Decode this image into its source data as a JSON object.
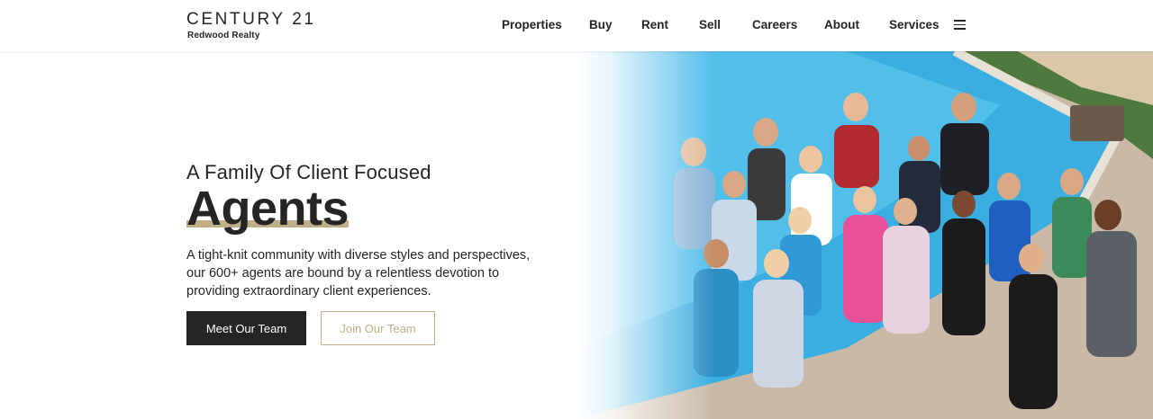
{
  "brand": {
    "name": "CENTURY 21",
    "office": "Redwood Realty"
  },
  "nav": {
    "items": [
      {
        "label": "Properties",
        "id": "properties"
      },
      {
        "label": "Buy",
        "id": "buy"
      },
      {
        "label": "Rent",
        "id": "rent"
      },
      {
        "label": "Sell",
        "id": "sell"
      },
      {
        "label": "Careers",
        "id": "careers"
      },
      {
        "label": "About",
        "id": "about"
      },
      {
        "label": "Services",
        "id": "services"
      }
    ],
    "menu_icon": "hamburger-menu-icon"
  },
  "hero": {
    "eyebrow": "A Family Of Client Focused",
    "headline": "Agents",
    "description": "A tight-knit community with diverse styles and perspectives, our 600+ agents are bound by a relentless devotion to providing extraordinary client experiences.",
    "primary_button": "Meet Our Team",
    "secondary_button": "Join Our Team",
    "image_subject": "group-photo-of-agents-by-pool"
  },
  "colors": {
    "text": "#252526",
    "accent_gold": "#beaf87",
    "background": "#ffffff",
    "pool_blue": "#3aaee0"
  }
}
